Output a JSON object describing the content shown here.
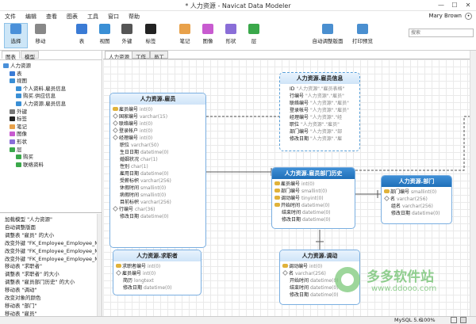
{
  "window": {
    "title": "* 人力资源 - Navicat Data Modeler",
    "min": "—",
    "max": "☐",
    "close": "✕"
  },
  "menu": [
    "文件",
    "编辑",
    "查看",
    "图表",
    "工具",
    "窗口",
    "帮助"
  ],
  "user": "Mary Brown",
  "toolbar": {
    "items": [
      {
        "label": "选择",
        "icon": "cursor-icon",
        "color": "#4a90d9"
      },
      {
        "label": "移动",
        "icon": "hand-icon",
        "color": "#888"
      },
      {
        "label": "表",
        "icon": "table-icon",
        "color": "#3a7bd5"
      },
      {
        "label": "视图",
        "icon": "view-icon",
        "color": "#3a8fd5"
      },
      {
        "label": "外键",
        "icon": "foreign-key-icon",
        "color": "#555"
      },
      {
        "label": "标签",
        "icon": "label-icon",
        "color": "#222"
      },
      {
        "label": "笔记",
        "icon": "note-icon",
        "color": "#e8a14a"
      },
      {
        "label": "图像",
        "icon": "image-icon",
        "color": "#c85bd0"
      },
      {
        "label": "形状",
        "icon": "shape-icon",
        "color": "#8a6ed8"
      },
      {
        "label": "层",
        "icon": "layer-icon",
        "color": "#3aa84a"
      },
      {
        "label": "自动调整版面",
        "icon": "auto-layout-icon",
        "color": "#4a8fd0"
      },
      {
        "label": "打印预览",
        "icon": "print-preview-icon",
        "color": "#4a8fd0"
      }
    ],
    "search_placeholder": "搜索"
  },
  "left_tabs": [
    "图表",
    "模型"
  ],
  "tree": [
    {
      "label": "人力资源",
      "indent": 0,
      "icon": "diagram-icon",
      "color": "#4a90d9"
    },
    {
      "label": "表",
      "indent": 1,
      "icon": "table-icon",
      "color": "#3a7bd5"
    },
    {
      "label": "视图",
      "indent": 1,
      "icon": "view-icon",
      "color": "#3a8fd5"
    },
    {
      "label": "个人资料.雇员信息",
      "indent": 2,
      "icon": "view-icon",
      "color": "#3a8fd5"
    },
    {
      "label": "购买.供应信息",
      "indent": 2,
      "icon": "view-icon",
      "color": "#3a8fd5"
    },
    {
      "label": "人力资源.雇员信息",
      "indent": 2,
      "icon": "view-icon",
      "color": "#3a8fd5"
    },
    {
      "label": "外键",
      "indent": 1,
      "icon": "foreign-key-icon",
      "color": "#777"
    },
    {
      "label": "标签",
      "indent": 1,
      "icon": "label-icon",
      "color": "#222"
    },
    {
      "label": "笔记",
      "indent": 1,
      "icon": "note-icon",
      "color": "#e8a14a"
    },
    {
      "label": "图像",
      "indent": 1,
      "icon": "image-icon",
      "color": "#c85bd0"
    },
    {
      "label": "形状",
      "indent": 1,
      "icon": "shape-icon",
      "color": "#8a6ed8"
    },
    {
      "label": "层",
      "indent": 1,
      "icon": "layer-icon",
      "color": "#3aa84a"
    },
    {
      "label": "购买",
      "indent": 2,
      "icon": "layer-icon",
      "color": "#3aa84a"
    },
    {
      "label": "联络资料",
      "indent": 2,
      "icon": "layer-icon",
      "color": "#3aa84a"
    }
  ],
  "history": [
    "加载模型 \"人力资源\"",
    "自动调整版面",
    "调整表 \"雇员\" 的大小",
    "改变外键 \"FK_Employee_Employee_Man",
    "改变外键 \"FK_Employee_Employee_Man",
    "改变外键 \"FK_Employee_Employee_Man",
    "移动表 \"求职者\"",
    "调整表 \"求职者\" 的大小",
    "调整表 \"雇员部门历史\" 的大小",
    "移动表 \"调动\"",
    "改变对象的颜色",
    "移动表 \"部门\"",
    "移动表 \"雇员\""
  ],
  "canvas_tabs": [
    "人力资源",
    "工作",
    "员工"
  ],
  "entities": {
    "employee": {
      "title": "人力资源.雇员",
      "fields": [
        {
          "k": "pk",
          "n": "雇员编号",
          "t": "int(0)"
        },
        {
          "k": "d",
          "n": "国家编号",
          "t": "varchar(15)"
        },
        {
          "k": "d",
          "n": "联络编号",
          "t": "int(0)"
        },
        {
          "k": "d",
          "n": "登录帐户",
          "t": "int(0)"
        },
        {
          "k": "d",
          "n": "经理编号",
          "t": "int(0)"
        },
        {
          "k": "",
          "n": "职位",
          "t": "varchar(50)"
        },
        {
          "k": "",
          "n": "生日日期",
          "t": "datetime(0)"
        },
        {
          "k": "",
          "n": "婚姻状况",
          "t": "char(1)"
        },
        {
          "k": "",
          "n": "性别",
          "t": "char(1)"
        },
        {
          "k": "",
          "n": "雇用日期",
          "t": "datetime(0)"
        },
        {
          "k": "",
          "n": "受薪标帜",
          "t": "varchar(256)"
        },
        {
          "k": "",
          "n": "休假时间",
          "t": "smallint(0)"
        },
        {
          "k": "",
          "n": "病假时间",
          "t": "smallint(0)"
        },
        {
          "k": "",
          "n": "目前标帜",
          "t": "varchar(256)"
        },
        {
          "k": "d",
          "n": "行编号",
          "t": "char(36)"
        },
        {
          "k": "",
          "n": "修改日期",
          "t": "datetime(0)"
        }
      ]
    },
    "info": {
      "title": "人力资源.雇员信息",
      "fields": [
        {
          "k": "",
          "n": "ID",
          "t": "\"人力资源\".\"雇员表格\""
        },
        {
          "k": "",
          "n": "行编号",
          "t": "\"人力资源\".\"雇员\""
        },
        {
          "k": "",
          "n": "联络编号",
          "t": "\"人力资源\".\"雇员\""
        },
        {
          "k": "",
          "n": "登录帐号",
          "t": "\"人力资源\".\"雇员\""
        },
        {
          "k": "",
          "n": "经理编号",
          "t": "\"人力资源\".\"经"
        },
        {
          "k": "",
          "n": "职位",
          "t": "\"人力资源\".\"雇员\""
        },
        {
          "k": "",
          "n": "部门编号",
          "t": "\"人力资源\".\"部"
        },
        {
          "k": "",
          "n": "修改日期",
          "t": "\"人力资源\".\"雇"
        }
      ]
    },
    "history": {
      "title": "人力资源.雇员部门历史",
      "fields": [
        {
          "k": "pk",
          "n": "雇员编号",
          "t": "int(0)"
        },
        {
          "k": "pk",
          "n": "部门编号",
          "t": "smallint(0)"
        },
        {
          "k": "pk",
          "n": "调动编号",
          "t": "tinyint(0)"
        },
        {
          "k": "pk",
          "n": "开始时间",
          "t": "datetime(0)"
        },
        {
          "k": "",
          "n": "结束时间",
          "t": "datetime(0)"
        },
        {
          "k": "",
          "n": "修改日期",
          "t": "datetime(0)"
        }
      ]
    },
    "dept": {
      "title": "人力资源.部门",
      "fields": [
        {
          "k": "pk",
          "n": "部门编号",
          "t": "smallint(0)"
        },
        {
          "k": "d",
          "n": "名",
          "t": "varchar(256)"
        },
        {
          "k": "",
          "n": "组名",
          "t": "varchar(256)"
        },
        {
          "k": "",
          "n": "修改日期",
          "t": "datetime(0)"
        }
      ]
    },
    "candidate": {
      "title": "人力资源.求职者",
      "fields": [
        {
          "k": "pk",
          "n": "求职者编号",
          "t": "int(0)"
        },
        {
          "k": "d",
          "n": "雇员编号",
          "t": "int(0)"
        },
        {
          "k": "",
          "n": "简历",
          "t": "longtext"
        },
        {
          "k": "",
          "n": "修改日期",
          "t": "datetime(0)"
        }
      ]
    },
    "transfer": {
      "title": "人力资源.调动",
      "fields": [
        {
          "k": "pk",
          "n": "调动编号",
          "t": "int(0)"
        },
        {
          "k": "d",
          "n": "名",
          "t": "varchar(256)"
        },
        {
          "k": "",
          "n": "开始时间",
          "t": "datetime(0)"
        },
        {
          "k": "",
          "n": "结束时间",
          "t": "datetime(0)"
        },
        {
          "k": "",
          "n": "修改日期",
          "t": "datetime(0)"
        }
      ]
    }
  },
  "status": {
    "db": "MySQL 5.6",
    "zoom": "100%"
  },
  "watermark": {
    "cn": "多多软件站",
    "url": "www.ddooo.com"
  }
}
